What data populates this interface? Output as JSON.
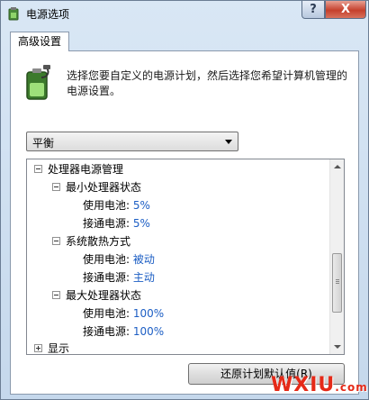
{
  "window": {
    "title": "电源选项",
    "help_label": "?",
    "close_label": "X"
  },
  "tab": {
    "label": "高级设置"
  },
  "description": "选择您要自定义的电源计划，然后选择您希望计算机管理的电源设置。",
  "plan_select": {
    "value": "平衡"
  },
  "tree": {
    "items": [
      {
        "label": "处理器电源管理",
        "expander": "minus"
      },
      {
        "label": "最小处理器状态",
        "expander": "minus"
      },
      {
        "label": "使用电池:",
        "value": "5%"
      },
      {
        "label": "接通电源:",
        "value": "5%"
      },
      {
        "label": "系统散热方式",
        "expander": "minus"
      },
      {
        "label": "使用电池:",
        "value": "被动"
      },
      {
        "label": "接通电源:",
        "value": "主动"
      },
      {
        "label": "最大处理器状态",
        "expander": "minus"
      },
      {
        "label": "使用电池:",
        "value": "100%"
      },
      {
        "label": "接通电源:",
        "value": "100%"
      },
      {
        "label": "显示",
        "expander": "plus"
      }
    ]
  },
  "restore_button": {
    "label": "还原计划默认值(R)"
  },
  "watermark": {
    "text": "WXIU",
    "suffix": ".com"
  },
  "colors": {
    "value_blue": "#1c5ec4",
    "watermark_red": "#e52a18"
  }
}
